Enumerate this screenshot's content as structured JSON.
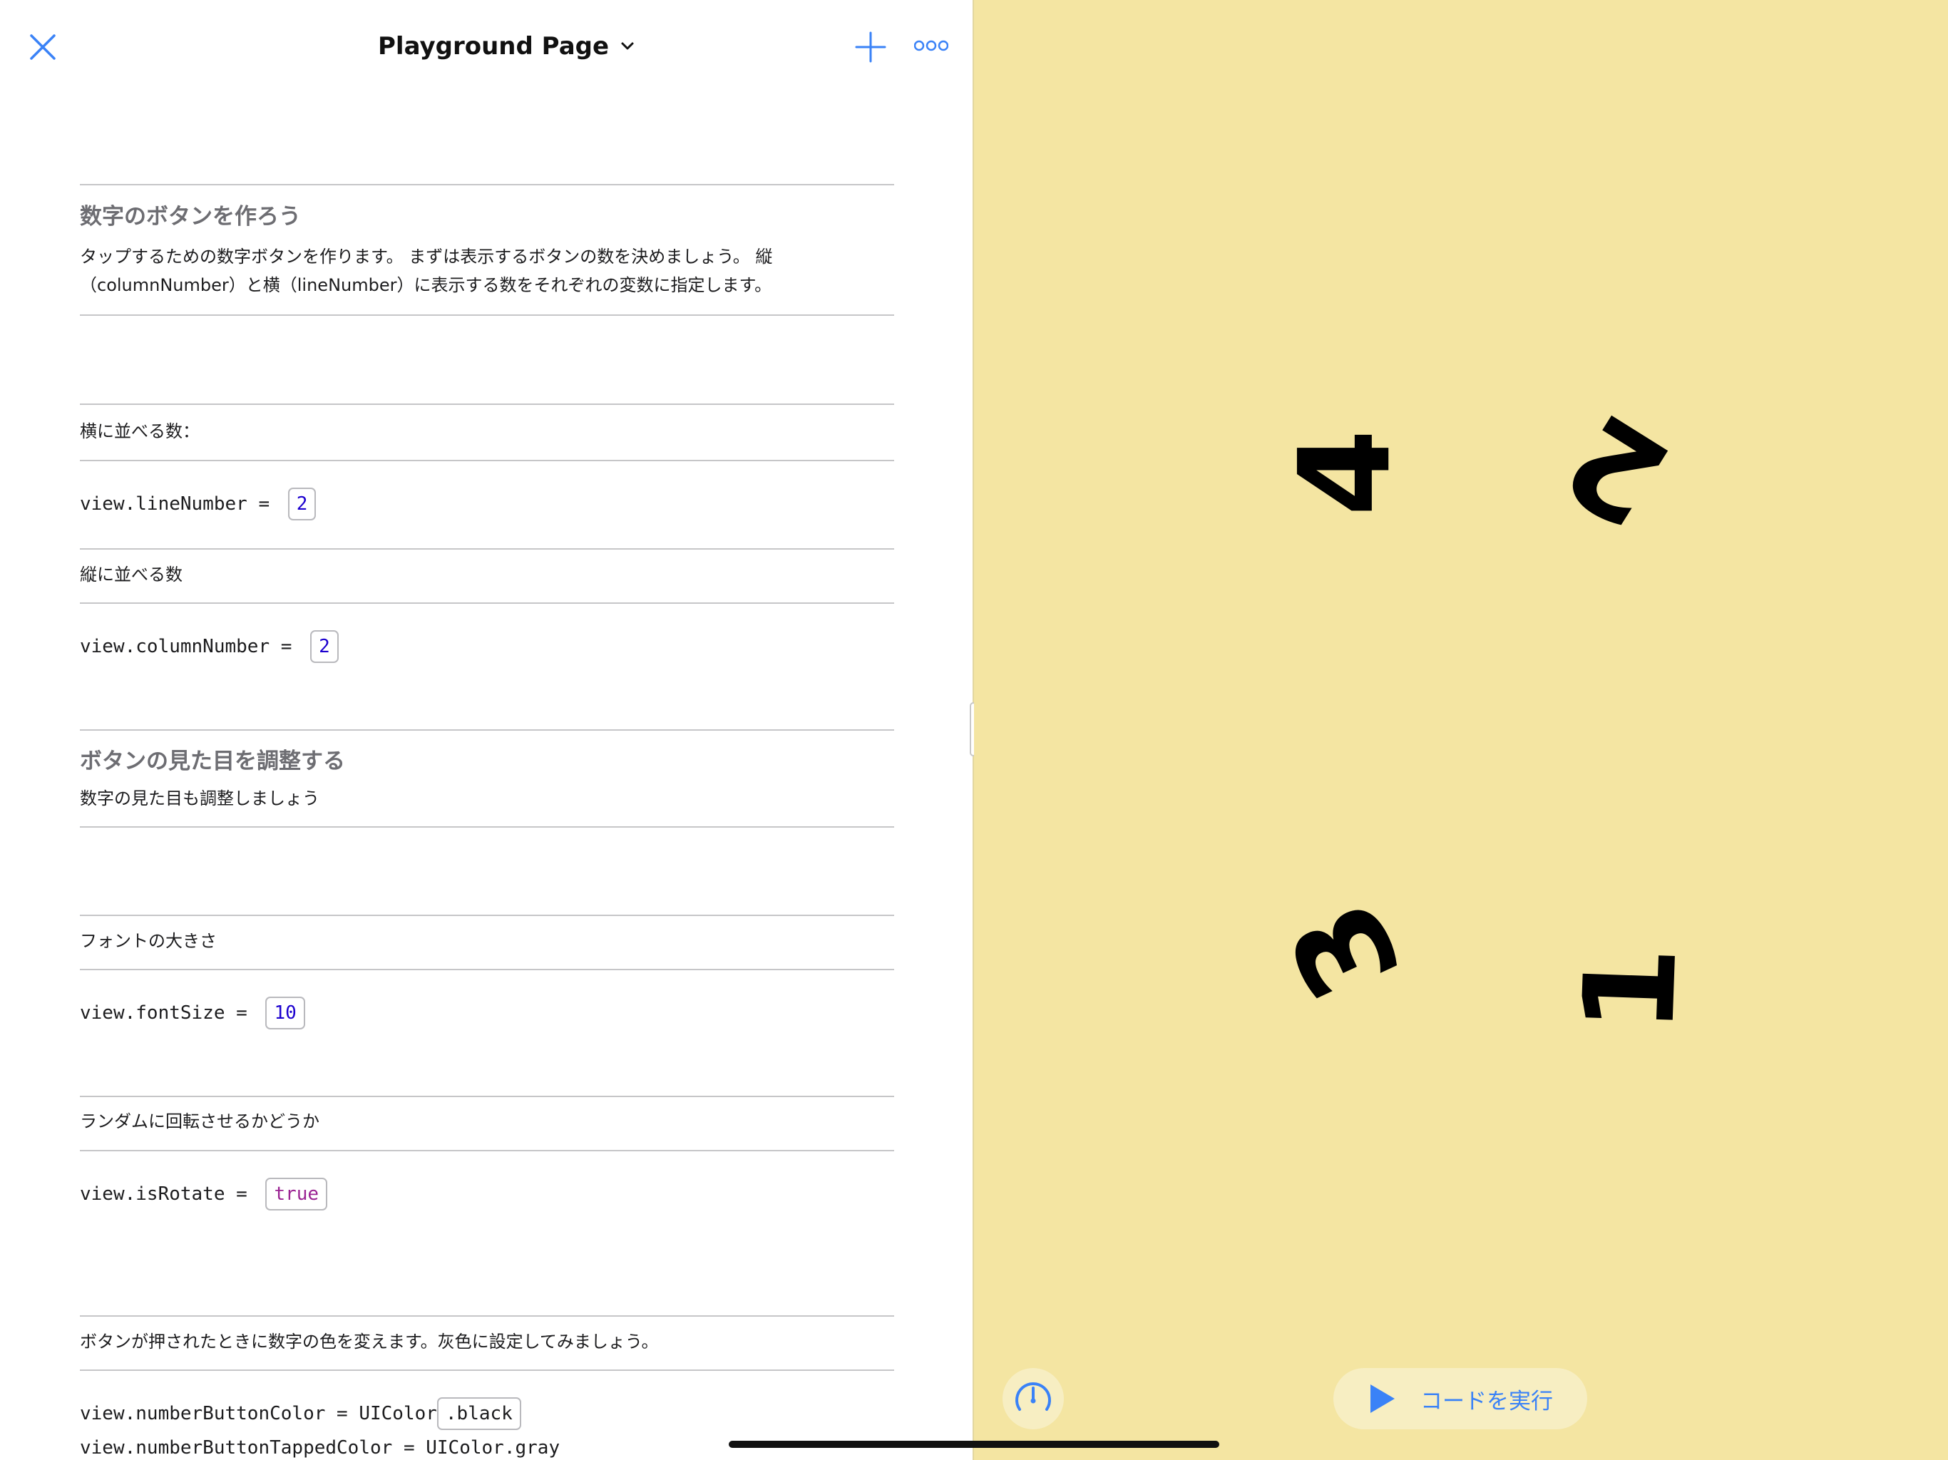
{
  "nav": {
    "title": "Playground Page",
    "accent_color": "#3a82f7",
    "icons": [
      "close-icon",
      "chevron-down-icon",
      "add-icon",
      "more-icon"
    ]
  },
  "sections": {
    "intro": {
      "heading": "数字のボタンを作ろう",
      "text_line1": "タップするための数字ボタンを作ります。 まずは表示するボタンの数を決めましょう。 縦",
      "text_line2": "（columnNumber）と横（lineNumber）に表示する数をそれぞれの変数に指定します。"
    },
    "line_number": {
      "comment": "横に並べる数：",
      "code": "view.lineNumber = ",
      "value": "2"
    },
    "column_number": {
      "comment": "縦に並べる数",
      "code": "view.columnNumber = ",
      "value": "2"
    },
    "appearance": {
      "heading": "ボタンの見た目を調整する",
      "text": "数字の見た目も調整しましょう"
    },
    "font_size": {
      "comment": "フォントの大きさ",
      "code": "view.fontSize = ",
      "value": "10"
    },
    "rotate": {
      "comment": "ランダムに回転させるかどうか",
      "code": "view.isRotate = ",
      "value": "true"
    },
    "button_color": {
      "comment": "ボタンが押されたときに数字の色を変えます。灰色に設定してみましょう。",
      "code1": "view.numberButtonColor = UIColor",
      "value1": ".black",
      "code2": "view.numberButtonTappedColor = UIColor.gray"
    }
  },
  "live_view": {
    "background_color": "#f4e5a2",
    "digits": [
      "4",
      "2",
      "3",
      "1"
    ]
  },
  "controls": {
    "run_label": "コードを実行",
    "icons": [
      "speedometer-icon",
      "play-icon"
    ]
  }
}
